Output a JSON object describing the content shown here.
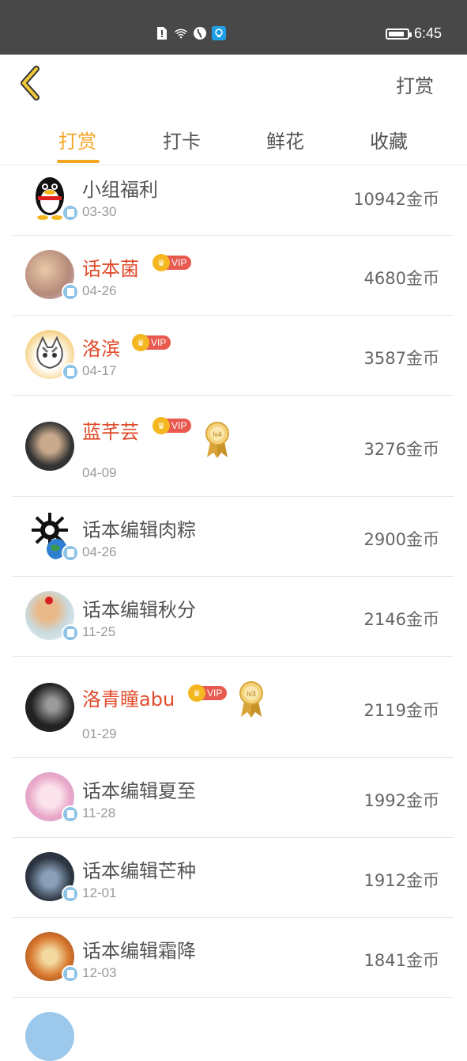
{
  "status_bar": {
    "time": "6:45",
    "icons": [
      "sim-alert-icon",
      "wifi-icon",
      "globe-icon",
      "lightbulb-icon"
    ],
    "battery_level": 0.85
  },
  "header": {
    "back_icon": "chevron-left-icon",
    "title": "打赏"
  },
  "tabs": [
    {
      "label": "打赏",
      "active": true
    },
    {
      "label": "打卡",
      "active": false
    },
    {
      "label": "鲜花",
      "active": false
    },
    {
      "label": "收藏",
      "active": false
    }
  ],
  "colors": {
    "accent": "#f5a623",
    "vip_name": "#e04a2a",
    "vip_badge": "#e85a4f",
    "status_bar": "#484848"
  },
  "rewards": [
    {
      "name": "小组福利",
      "date": "03-30",
      "amount": "10942金币",
      "vip": false,
      "medal": ""
    },
    {
      "name": "话本菌",
      "date": "04-26",
      "amount": "4680金币",
      "vip": true,
      "medal": ""
    },
    {
      "name": "洛滨",
      "date": "04-17",
      "amount": "3587金币",
      "vip": true,
      "medal": ""
    },
    {
      "name": "蓝芊芸",
      "date": "04-09",
      "amount": "3276金币",
      "vip": true,
      "medal": "lv4"
    },
    {
      "name": "话本编辑肉粽",
      "date": "04-26",
      "amount": "2900金币",
      "vip": false,
      "medal": ""
    },
    {
      "name": "话本编辑秋分",
      "date": "11-25",
      "amount": "2146金币",
      "vip": false,
      "medal": ""
    },
    {
      "name": "洛青瞳abu",
      "date": "01-29",
      "amount": "2119金币",
      "vip": true,
      "medal": "lv3"
    },
    {
      "name": "话本编辑夏至",
      "date": "11-28",
      "amount": "1992金币",
      "vip": false,
      "medal": ""
    },
    {
      "name": "话本编辑芒种",
      "date": "12-01",
      "amount": "1912金币",
      "vip": false,
      "medal": ""
    },
    {
      "name": "话本编辑霜降",
      "date": "12-03",
      "amount": "1841金币",
      "vip": false,
      "medal": ""
    }
  ],
  "vip_label": "VIP"
}
